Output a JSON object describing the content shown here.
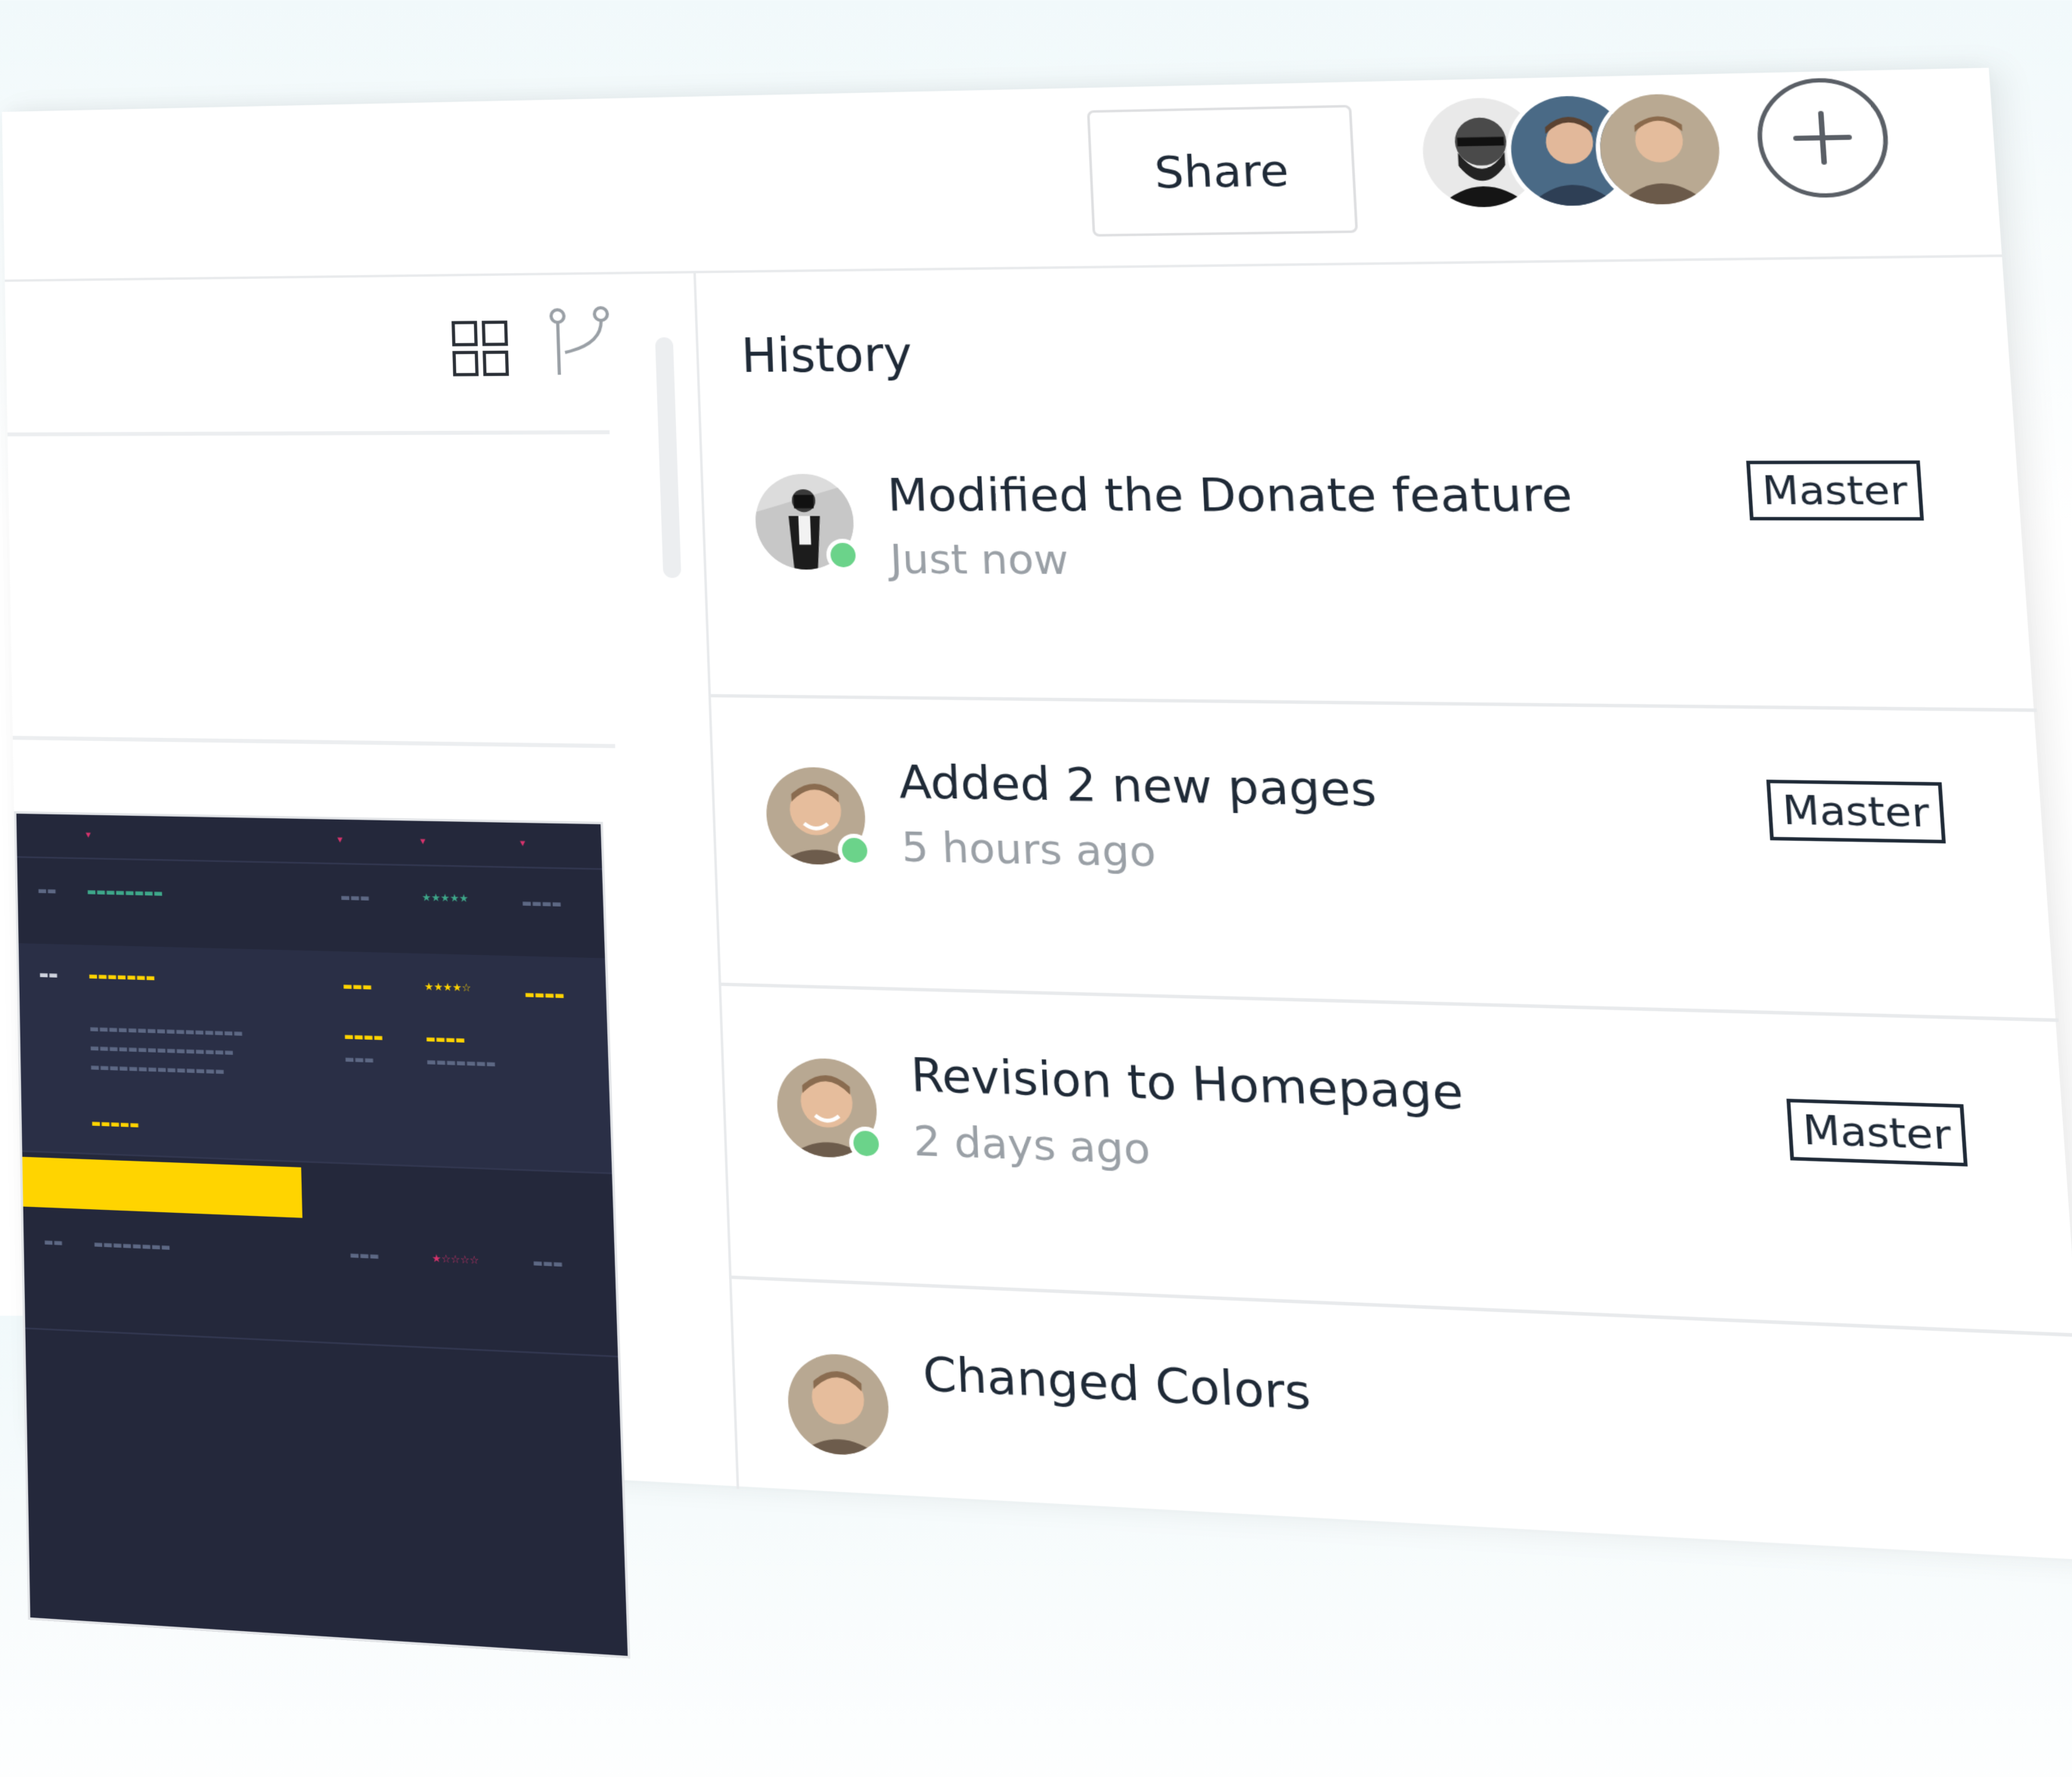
{
  "toolbar": {
    "share_label": "Share",
    "collaborators": [
      {
        "name": "collaborator-1",
        "style": "dark"
      },
      {
        "name": "collaborator-2",
        "style": "blue"
      },
      {
        "name": "collaborator-3",
        "style": "stone"
      }
    ],
    "add_icon": "plus-icon"
  },
  "left_panel": {
    "icons": [
      "grid-view-icon",
      "branch-icon"
    ]
  },
  "history": {
    "title": "History",
    "items": [
      {
        "title": "Modified the Donate feature",
        "time": "Just now",
        "branch": "Master",
        "avatar": "photographer"
      },
      {
        "title": "Added 2 new pages",
        "time": "5 hours ago",
        "branch": "Master",
        "avatar": "smiling-man"
      },
      {
        "title": "Revision to Homepage",
        "time": "2 days ago",
        "branch": "Master",
        "avatar": "smiling-man"
      },
      {
        "title": "Changed Colors",
        "time": "",
        "branch": "",
        "avatar": "smiling-man"
      }
    ]
  },
  "colors": {
    "accent_yellow": "#ffd400",
    "online_green": "#6bd38a",
    "thumbnail_bg": "#24283b"
  }
}
